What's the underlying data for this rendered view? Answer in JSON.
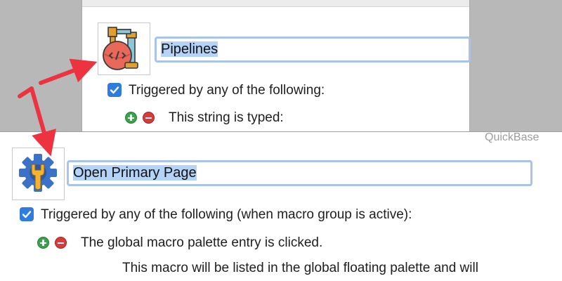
{
  "back_macro": {
    "name_value": "Pipelines",
    "icon": "pipeline-code-icon",
    "trigger_label": "Triggered by any of the following:",
    "trigger_checked": true,
    "trigger_item": "This string is typed:"
  },
  "front_macro": {
    "group_label": "QuickBase",
    "name_value": "Open Primary Page",
    "icon": "gear-wrench-icon",
    "trigger_label": "Triggered by any of the following (when macro group is active):",
    "trigger_checked": true,
    "trigger_item": "The global macro palette entry is clicked.",
    "description": "This macro will be listed in the global floating palette and will"
  },
  "colors": {
    "arrow": "#ee3340",
    "checkbox": "#2f7ce0",
    "field_border": "#a8c4ee",
    "selection": "#b5d3f7",
    "add": "#3aa24a",
    "remove": "#d93b3b"
  }
}
